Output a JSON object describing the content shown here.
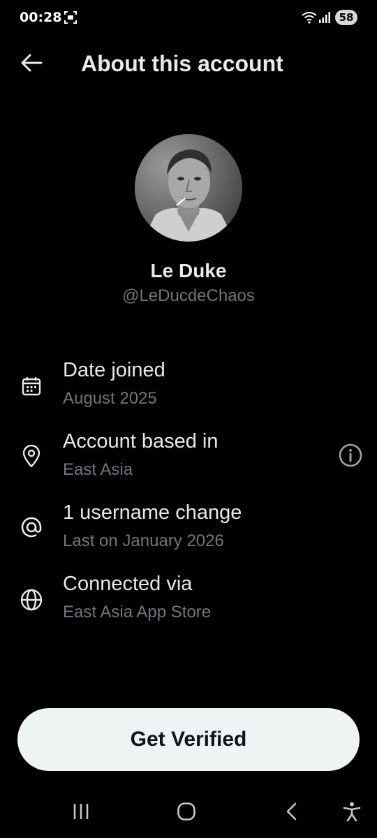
{
  "status_bar": {
    "time": "00:28",
    "battery": "58",
    "icons": [
      "screen-record-icon",
      "wifi-icon",
      "signal-icon",
      "battery-icon"
    ]
  },
  "header": {
    "title": "About this account",
    "back_icon": "arrow-left-icon"
  },
  "profile": {
    "display_name": "Le Duke",
    "handle": "@LeDucdeChaos",
    "avatar_icon": "profile-photo"
  },
  "info": [
    {
      "icon": "calendar-icon",
      "title": "Date joined",
      "subtitle": "August 2025"
    },
    {
      "icon": "location-pin-icon",
      "title": "Account based in",
      "subtitle": "East Asia",
      "action_icon": "info-icon"
    },
    {
      "icon": "at-sign-icon",
      "title": "1 username change",
      "subtitle": "Last on January 2026"
    },
    {
      "icon": "globe-icon",
      "title": "Connected via",
      "subtitle": "East Asia App Store"
    }
  ],
  "cta": {
    "label": "Get Verified"
  },
  "nav": {
    "icons": [
      "recent-apps-icon",
      "home-icon",
      "back-icon",
      "accessibility-icon"
    ]
  },
  "colors": {
    "background": "#000000",
    "text_primary": "#e7e9ea",
    "text_secondary": "#71767b",
    "button_bg": "#eff3f4",
    "button_text": "#0f1419"
  }
}
